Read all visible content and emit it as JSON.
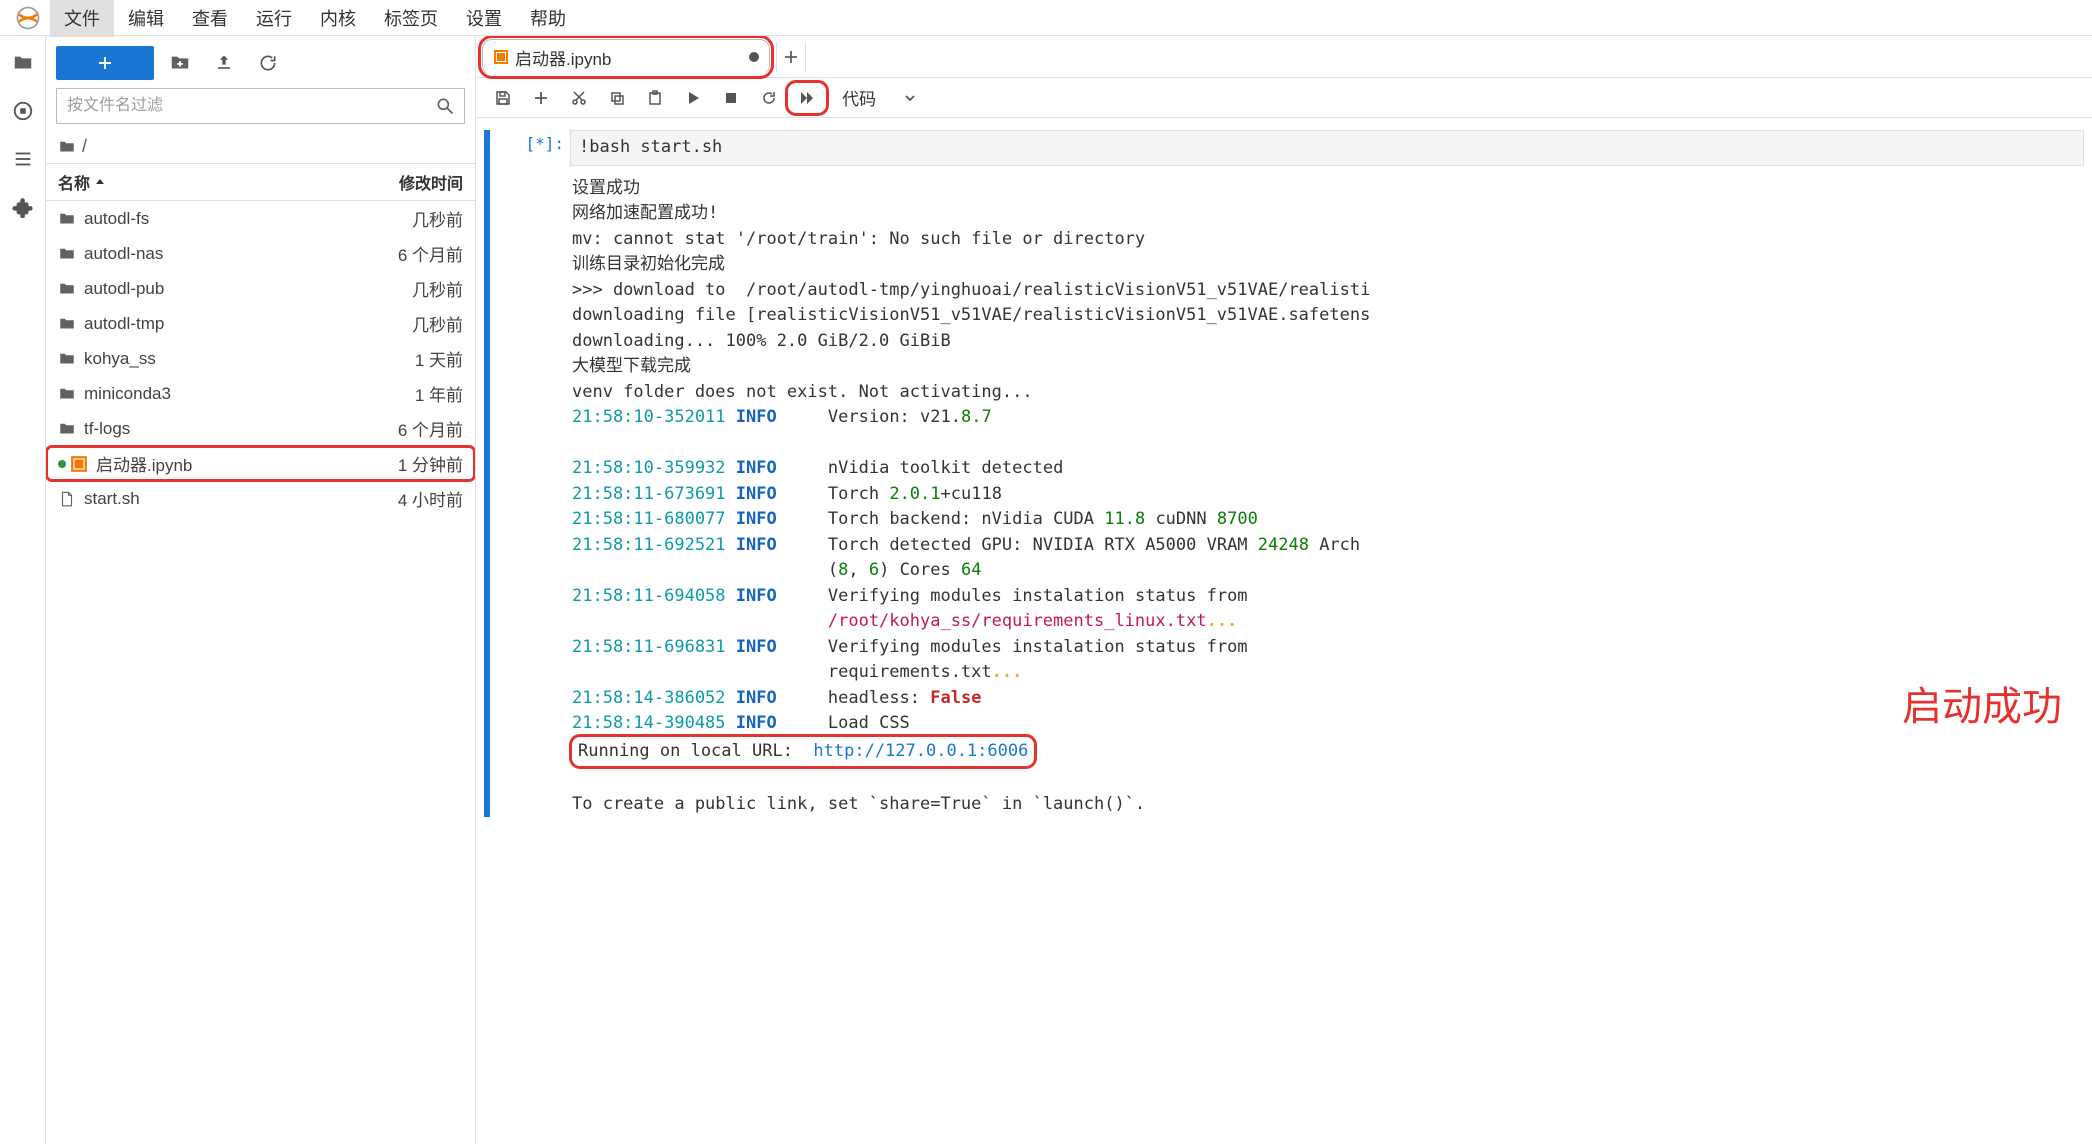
{
  "menu": {
    "items": [
      "文件",
      "编辑",
      "查看",
      "运行",
      "内核",
      "标签页",
      "设置",
      "帮助"
    ],
    "active": 0
  },
  "filePanel": {
    "filterPlaceholder": "按文件名过滤",
    "breadcrumb": "/",
    "header": {
      "name": "名称",
      "modified": "修改时间"
    },
    "rows": [
      {
        "type": "folder",
        "name": "autodl-fs",
        "time": "几秒前"
      },
      {
        "type": "folder",
        "name": "autodl-nas",
        "time": "6 个月前"
      },
      {
        "type": "folder",
        "name": "autodl-pub",
        "time": "几秒前"
      },
      {
        "type": "folder",
        "name": "autodl-tmp",
        "time": "几秒前"
      },
      {
        "type": "folder",
        "name": "kohya_ss",
        "time": "1 天前"
      },
      {
        "type": "folder",
        "name": "miniconda3",
        "time": "1 年前"
      },
      {
        "type": "folder",
        "name": "tf-logs",
        "time": "6 个月前"
      },
      {
        "type": "notebook",
        "name": "启动器.ipynb",
        "time": "1 分钟前",
        "running": true,
        "highlighted": true
      },
      {
        "type": "file",
        "name": "start.sh",
        "time": "4 小时前"
      }
    ]
  },
  "tab": {
    "title": "启动器.ipynb",
    "dirty": true
  },
  "toolbar": {
    "cellType": "代码"
  },
  "cell": {
    "prompt": "[*]:",
    "code": "!bash start.sh",
    "out": {
      "l1": "设置成功",
      "l2": "网络加速配置成功!",
      "l3": "mv: cannot stat '/root/train': No such file or directory",
      "l4": "训练目录初始化完成",
      "l5": ">>> download to  /root/autodl-tmp/yinghuoai/realisticVisionV51_v51VAE/realisti",
      "l6": "downloading file [realisticVisionV51_v51VAE/realisticVisionV51_v51VAE.safetens",
      "l7": "downloading... 100% 2.0 GiB/2.0 GiBiB",
      "l8": "大模型下载完成",
      "l9": "venv folder does not exist. Not activating...",
      "s1_ts": "21:58:10-352011",
      "s1_lv": "INFO",
      "s1_msg_a": "Version: v21.",
      "s1_msg_b": "8.7",
      "s2_ts": "21:58:10-359932",
      "s2_lv": "INFO",
      "s2_msg": "nVidia toolkit detected",
      "s3_ts": "21:58:11-673691",
      "s3_lv": "INFO",
      "s3_msg_a": "Torch ",
      "s3_n": "2.0.1",
      "s3_msg_b": "+cu118",
      "s4_ts": "21:58:11-680077",
      "s4_lv": "INFO",
      "s4_msg_a": "Torch backend: nVidia CUDA ",
      "s4_n1": "11.8",
      "s4_msg_b": " cuDNN ",
      "s4_n2": "8700",
      "s5_ts": "21:58:11-692521",
      "s5_lv": "INFO",
      "s5_msg_a": "Torch detected GPU: NVIDIA RTX A5000 VRAM ",
      "s5_n1": "24248",
      "s5_msg_b": " Arch",
      "s5b_open": "(",
      "s5b_n1": "8",
      "s5b_mid": ", ",
      "s5b_n2": "6",
      "s5b_close": ") Cores ",
      "s5b_n3": "64",
      "s6_ts": "21:58:11-694058",
      "s6_lv": "INFO",
      "s6_msg": "Verifying modules instalation status from",
      "s6b_path": "/root/kohya_ss/requirements_linux.txt",
      "s6b_dots": "...",
      "s7_ts": "21:58:11-696831",
      "s7_lv": "INFO",
      "s7_msg": "Verifying modules instalation status from",
      "s7b_msg": "requirements.txt",
      "s7b_dots": "...",
      "s8_ts": "21:58:14-386052",
      "s8_lv": "INFO",
      "s8_msg_a": "headless: ",
      "s8_false": "False",
      "s9_ts": "21:58:14-390485",
      "s9_lv": "INFO",
      "s9_msg": "Load CSS",
      "url_label": "Running on local URL:  ",
      "url": "http://127.0.0.1:6006",
      "footer": "To create a public link, set `share=True` in `launch()`."
    }
  },
  "annotation": "启动成功"
}
